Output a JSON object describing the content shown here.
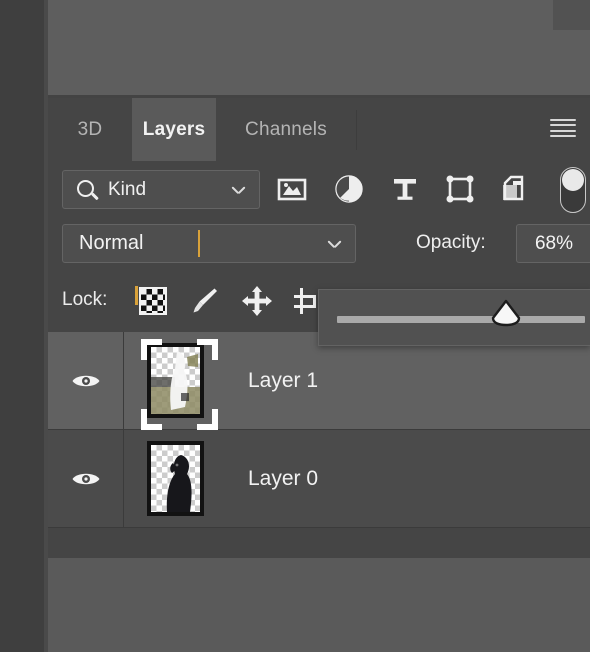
{
  "panel": {
    "title": "Layers",
    "menu_icon": "hamburger-menu-icon",
    "tabs": [
      {
        "label": "3D",
        "active": false
      },
      {
        "label": "Layers",
        "active": true
      },
      {
        "label": "Channels",
        "active": false
      }
    ]
  },
  "filter": {
    "search_icon": "magnifier-icon",
    "kind_value": "Kind",
    "kind_chevron": "chevron-down-icon",
    "type_filters": [
      {
        "name": "filter-pixel-layers-icon",
        "label": "Pixel layers"
      },
      {
        "name": "filter-adjustment-layers-icon",
        "label": "Adjustment layers"
      },
      {
        "name": "filter-type-layers-icon",
        "label": "Type layers"
      },
      {
        "name": "filter-shape-layers-icon",
        "label": "Shape layers"
      },
      {
        "name": "filter-smart-objects-icon",
        "label": "Smart objects"
      }
    ],
    "toggle_state": "off"
  },
  "blend": {
    "mode": "Normal",
    "mode_chevron": "chevron-down-icon",
    "opacity_label": "Opacity:",
    "opacity_value": "68%",
    "opacity_chevron": "chevron-down-icon",
    "opacity_percent": 68
  },
  "lock": {
    "label": "Lock:",
    "icons": [
      {
        "name": "lock-transparent-pixels-icon",
        "label": "Lock transparent pixels"
      },
      {
        "name": "lock-image-pixels-icon",
        "label": "Lock image pixels"
      },
      {
        "name": "lock-position-icon",
        "label": "Lock position"
      },
      {
        "name": "lock-artboard-nesting-icon",
        "label": "Prevent auto-nesting"
      }
    ]
  },
  "layers": [
    {
      "name": "Layer 1",
      "visible": true,
      "selected": true,
      "visibility_icon": "eye-icon",
      "thumbnail": "layer-1-thumbnail"
    },
    {
      "name": "Layer 0",
      "visible": true,
      "selected": false,
      "visibility_icon": "eye-icon",
      "thumbnail": "layer-0-thumbnail"
    }
  ],
  "colors": {
    "panel_bg": "#454545",
    "row_bg": "#4b4b4b",
    "row_selected_bg": "#616161",
    "app_bg": "#5a5a5a",
    "text": "#f2f2f2",
    "caret": "#d9a23a"
  }
}
